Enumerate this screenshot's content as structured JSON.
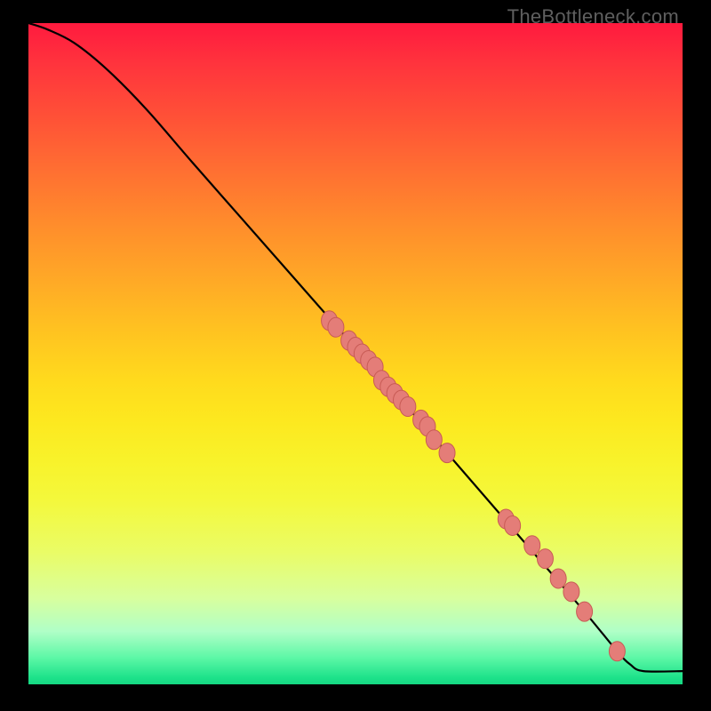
{
  "watermark": "TheBottleneck.com",
  "chart_data": {
    "type": "line",
    "title": "",
    "xlabel": "",
    "ylabel": "",
    "xlim": [
      0,
      100
    ],
    "ylim": [
      0,
      100
    ],
    "grid": false,
    "legend": false,
    "series": [
      {
        "name": "curve",
        "kind": "line",
        "x": [
          0,
          3,
          7,
          12,
          18,
          25,
          33,
          41,
          49,
          57,
          64,
          71,
          78,
          85,
          90,
          92,
          94,
          100
        ],
        "y": [
          100,
          99,
          97,
          93,
          87,
          79,
          70,
          61,
          52,
          43,
          35,
          27,
          19,
          11,
          5,
          3,
          2,
          2
        ]
      },
      {
        "name": "points",
        "kind": "scatter",
        "x": [
          46,
          47,
          49,
          50,
          51,
          52,
          53,
          54,
          55,
          56,
          57,
          58,
          60,
          61,
          62,
          64,
          73,
          74,
          77,
          79,
          81,
          83,
          85,
          90
        ],
        "y": [
          55,
          54,
          52,
          51,
          50,
          49,
          48,
          46,
          45,
          44,
          43,
          42,
          40,
          39,
          37,
          35,
          25,
          24,
          21,
          19,
          16,
          14,
          11,
          5
        ]
      }
    ],
    "colors": {
      "line": "#000000",
      "point_fill": "#e47d78",
      "point_stroke": "#c85b55"
    }
  }
}
